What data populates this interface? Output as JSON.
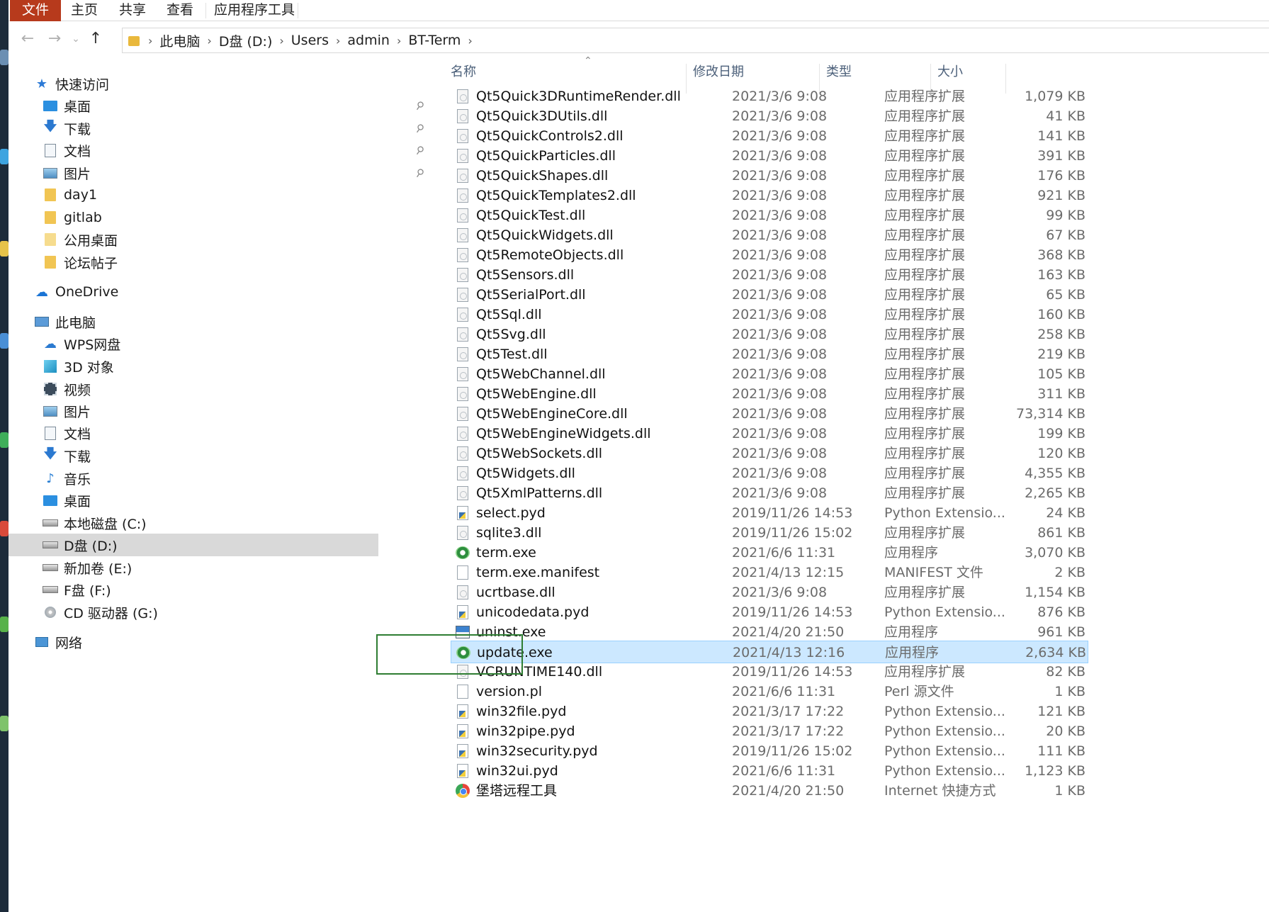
{
  "ribbon": {
    "tabs": [
      "文件",
      "主页",
      "共享",
      "查看",
      "应用程序工具"
    ]
  },
  "address": {
    "crumbs": [
      "此电脑",
      "D盘 (D:)",
      "Users",
      "admin",
      "BT-Term"
    ]
  },
  "nav": {
    "quick_access": "快速访问",
    "quick_items": [
      "桌面",
      "下载",
      "文档",
      "图片",
      "day1",
      "gitlab",
      "公用桌面",
      "论坛帖子"
    ],
    "onedrive": "OneDrive",
    "this_pc": "此电脑",
    "pc_items": [
      "WPS网盘",
      "3D 对象",
      "视频",
      "图片",
      "文档",
      "下载",
      "音乐",
      "桌面",
      "本地磁盘 (C:)",
      "D盘 (D:)",
      "新加卷 (E:)",
      "F盘 (F:)",
      "CD 驱动器 (G:)"
    ],
    "network": "网络"
  },
  "columns": {
    "name": "名称",
    "date": "修改日期",
    "type": "类型",
    "size": "大小"
  },
  "files": [
    {
      "name": "Qt5Quick3DRuntimeRender.dll",
      "date": "2021/3/6 9:08",
      "type": "应用程序扩展",
      "size": "1,079 KB",
      "icon": "dll"
    },
    {
      "name": "Qt5Quick3DUtils.dll",
      "date": "2021/3/6 9:08",
      "type": "应用程序扩展",
      "size": "41 KB",
      "icon": "dll"
    },
    {
      "name": "Qt5QuickControls2.dll",
      "date": "2021/3/6 9:08",
      "type": "应用程序扩展",
      "size": "141 KB",
      "icon": "dll"
    },
    {
      "name": "Qt5QuickParticles.dll",
      "date": "2021/3/6 9:08",
      "type": "应用程序扩展",
      "size": "391 KB",
      "icon": "dll"
    },
    {
      "name": "Qt5QuickShapes.dll",
      "date": "2021/3/6 9:08",
      "type": "应用程序扩展",
      "size": "176 KB",
      "icon": "dll"
    },
    {
      "name": "Qt5QuickTemplates2.dll",
      "date": "2021/3/6 9:08",
      "type": "应用程序扩展",
      "size": "921 KB",
      "icon": "dll"
    },
    {
      "name": "Qt5QuickTest.dll",
      "date": "2021/3/6 9:08",
      "type": "应用程序扩展",
      "size": "99 KB",
      "icon": "dll"
    },
    {
      "name": "Qt5QuickWidgets.dll",
      "date": "2021/3/6 9:08",
      "type": "应用程序扩展",
      "size": "67 KB",
      "icon": "dll"
    },
    {
      "name": "Qt5RemoteObjects.dll",
      "date": "2021/3/6 9:08",
      "type": "应用程序扩展",
      "size": "368 KB",
      "icon": "dll"
    },
    {
      "name": "Qt5Sensors.dll",
      "date": "2021/3/6 9:08",
      "type": "应用程序扩展",
      "size": "163 KB",
      "icon": "dll"
    },
    {
      "name": "Qt5SerialPort.dll",
      "date": "2021/3/6 9:08",
      "type": "应用程序扩展",
      "size": "65 KB",
      "icon": "dll"
    },
    {
      "name": "Qt5Sql.dll",
      "date": "2021/3/6 9:08",
      "type": "应用程序扩展",
      "size": "160 KB",
      "icon": "dll"
    },
    {
      "name": "Qt5Svg.dll",
      "date": "2021/3/6 9:08",
      "type": "应用程序扩展",
      "size": "258 KB",
      "icon": "dll"
    },
    {
      "name": "Qt5Test.dll",
      "date": "2021/3/6 9:08",
      "type": "应用程序扩展",
      "size": "219 KB",
      "icon": "dll"
    },
    {
      "name": "Qt5WebChannel.dll",
      "date": "2021/3/6 9:08",
      "type": "应用程序扩展",
      "size": "105 KB",
      "icon": "dll"
    },
    {
      "name": "Qt5WebEngine.dll",
      "date": "2021/3/6 9:08",
      "type": "应用程序扩展",
      "size": "311 KB",
      "icon": "dll"
    },
    {
      "name": "Qt5WebEngineCore.dll",
      "date": "2021/3/6 9:08",
      "type": "应用程序扩展",
      "size": "73,314 KB",
      "icon": "dll"
    },
    {
      "name": "Qt5WebEngineWidgets.dll",
      "date": "2021/3/6 9:08",
      "type": "应用程序扩展",
      "size": "199 KB",
      "icon": "dll"
    },
    {
      "name": "Qt5WebSockets.dll",
      "date": "2021/3/6 9:08",
      "type": "应用程序扩展",
      "size": "120 KB",
      "icon": "dll"
    },
    {
      "name": "Qt5Widgets.dll",
      "date": "2021/3/6 9:08",
      "type": "应用程序扩展",
      "size": "4,355 KB",
      "icon": "dll"
    },
    {
      "name": "Qt5XmlPatterns.dll",
      "date": "2021/3/6 9:08",
      "type": "应用程序扩展",
      "size": "2,265 KB",
      "icon": "dll"
    },
    {
      "name": "select.pyd",
      "date": "2019/11/26 14:53",
      "type": "Python Extensio...",
      "size": "24 KB",
      "icon": "pyd"
    },
    {
      "name": "sqlite3.dll",
      "date": "2019/11/26 15:02",
      "type": "应用程序扩展",
      "size": "861 KB",
      "icon": "dll"
    },
    {
      "name": "term.exe",
      "date": "2021/6/6 11:31",
      "type": "应用程序",
      "size": "3,070 KB",
      "icon": "exe"
    },
    {
      "name": "term.exe.manifest",
      "date": "2021/4/13 12:15",
      "type": "MANIFEST 文件",
      "size": "2 KB",
      "icon": "blank"
    },
    {
      "name": "ucrtbase.dll",
      "date": "2021/3/6 9:08",
      "type": "应用程序扩展",
      "size": "1,154 KB",
      "icon": "dll"
    },
    {
      "name": "unicodedata.pyd",
      "date": "2019/11/26 14:53",
      "type": "Python Extensio...",
      "size": "876 KB",
      "icon": "pyd"
    },
    {
      "name": "uninst.exe",
      "date": "2021/4/20 21:50",
      "type": "应用程序",
      "size": "961 KB",
      "icon": "uninst"
    },
    {
      "name": "update.exe",
      "date": "2021/4/13 12:16",
      "type": "应用程序",
      "size": "2,634 KB",
      "icon": "exe",
      "selected": true
    },
    {
      "name": "VCRUNTIME140.dll",
      "date": "2019/11/26 14:53",
      "type": "应用程序扩展",
      "size": "82 KB",
      "icon": "dll"
    },
    {
      "name": "version.pl",
      "date": "2021/6/6 11:31",
      "type": "Perl 源文件",
      "size": "1 KB",
      "icon": "blank"
    },
    {
      "name": "win32file.pyd",
      "date": "2021/3/17 17:22",
      "type": "Python Extensio...",
      "size": "121 KB",
      "icon": "pyd"
    },
    {
      "name": "win32pipe.pyd",
      "date": "2021/3/17 17:22",
      "type": "Python Extensio...",
      "size": "20 KB",
      "icon": "pyd"
    },
    {
      "name": "win32security.pyd",
      "date": "2019/11/26 15:02",
      "type": "Python Extensio...",
      "size": "111 KB",
      "icon": "pyd"
    },
    {
      "name": "win32ui.pyd",
      "date": "2021/6/6 11:31",
      "type": "Python Extensio...",
      "size": "1,123 KB",
      "icon": "pyd"
    },
    {
      "name": "堡塔远程工具",
      "date": "2021/4/20 21:50",
      "type": "Internet 快捷方式",
      "size": "1 KB",
      "icon": "link"
    }
  ],
  "colors": {
    "file_tab": "#b73a1c",
    "selection": "#cce8ff",
    "annotation_box": "#2e7d32"
  }
}
